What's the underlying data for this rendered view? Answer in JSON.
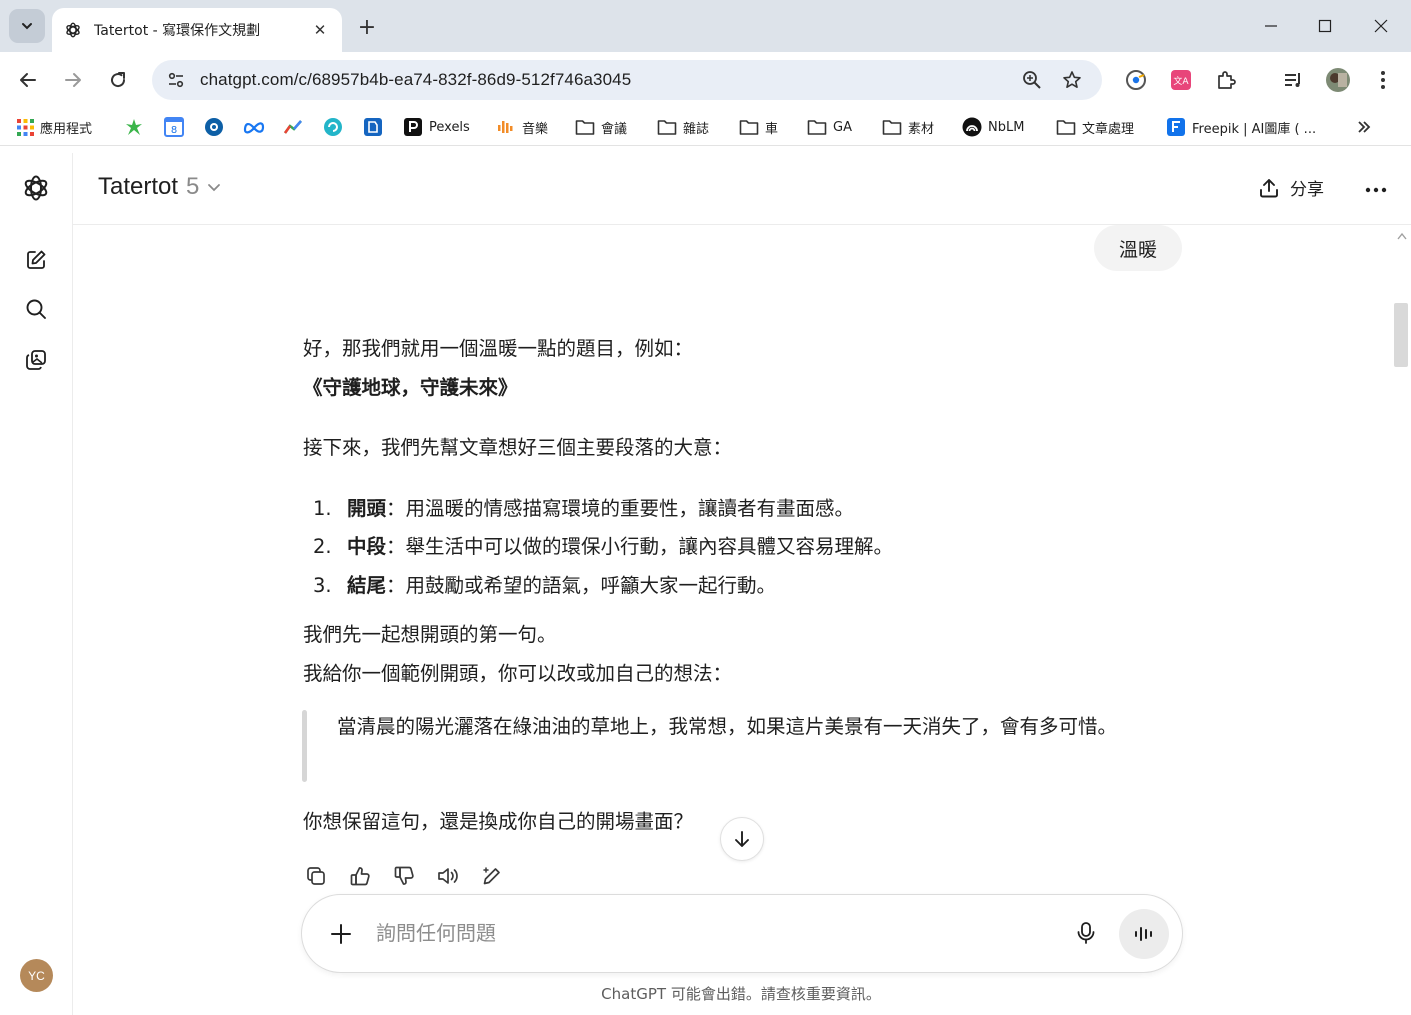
{
  "browser": {
    "tab_title": "Tatertot - 寫環保作文規劃",
    "url": "chatgpt.com/c/68957b4b-ea74-832f-86d9-512f746a3045",
    "bookmarks": [
      {
        "label": "應用程式",
        "icon": "apps-grid-icon"
      },
      {
        "label": "",
        "icon": "green-leaf-icon"
      },
      {
        "label": "",
        "icon": "calendar-icon"
      },
      {
        "label": "",
        "icon": "circle-app-icon"
      },
      {
        "label": "",
        "icon": "meta-icon"
      },
      {
        "label": "",
        "icon": "trend-icon"
      },
      {
        "label": "",
        "icon": "swirl-icon"
      },
      {
        "label": "",
        "icon": "blue-app-icon"
      },
      {
        "label": "Pexels",
        "icon": "pexels-icon"
      },
      {
        "label": "音樂",
        "icon": "music-bars-icon"
      },
      {
        "label": "會議",
        "icon": "folder-icon"
      },
      {
        "label": "雜誌",
        "icon": "folder-icon"
      },
      {
        "label": "車",
        "icon": "folder-icon"
      },
      {
        "label": "GA",
        "icon": "folder-icon"
      },
      {
        "label": "素材",
        "icon": "folder-icon"
      },
      {
        "label": "NbLM",
        "icon": "notebooklm-icon"
      },
      {
        "label": "文章處理",
        "icon": "folder-icon"
      },
      {
        "label": "Freepik | AI圖庫 ( ...",
        "icon": "freepik-icon"
      }
    ]
  },
  "header": {
    "model_name": "Tatertot",
    "model_version": "5",
    "share_label": "分享"
  },
  "sidebar": {
    "avatar_initials": "YC"
  },
  "conversation": {
    "user_message": "溫暖",
    "assistant": {
      "intro": "好，那我們就用一個溫暖一點的題目，例如：",
      "title": "《守護地球，守護未來》",
      "lead": "接下來，我們先幫文章想好三個主要段落的大意：",
      "list": [
        {
          "num": "1.",
          "term": "開頭",
          "text": "：用溫暖的情感描寫環境的重要性，讓讀者有畫面感。"
        },
        {
          "num": "2.",
          "term": "中段",
          "text": "：舉生活中可以做的環保小行動，讓內容具體又容易理解。"
        },
        {
          "num": "3.",
          "term": "結尾",
          "text": "：用鼓勵或希望的語氣，呼籲大家一起行動。"
        }
      ],
      "line1": "我們先一起想開頭的第一句。",
      "line2": "我給你一個範例開頭，你可以改或加自己的想法：",
      "quote": "當清晨的陽光灑落在綠油油的草地上，我常想，如果這片美景有一天消失了，會有多可惜。",
      "question": "你想保留這句，還是換成你自己的開場畫面？"
    }
  },
  "composer": {
    "placeholder": "詢問任何問題"
  },
  "footer": {
    "disclaimer": "ChatGPT 可能會出錯。請查核重要資訊。"
  }
}
